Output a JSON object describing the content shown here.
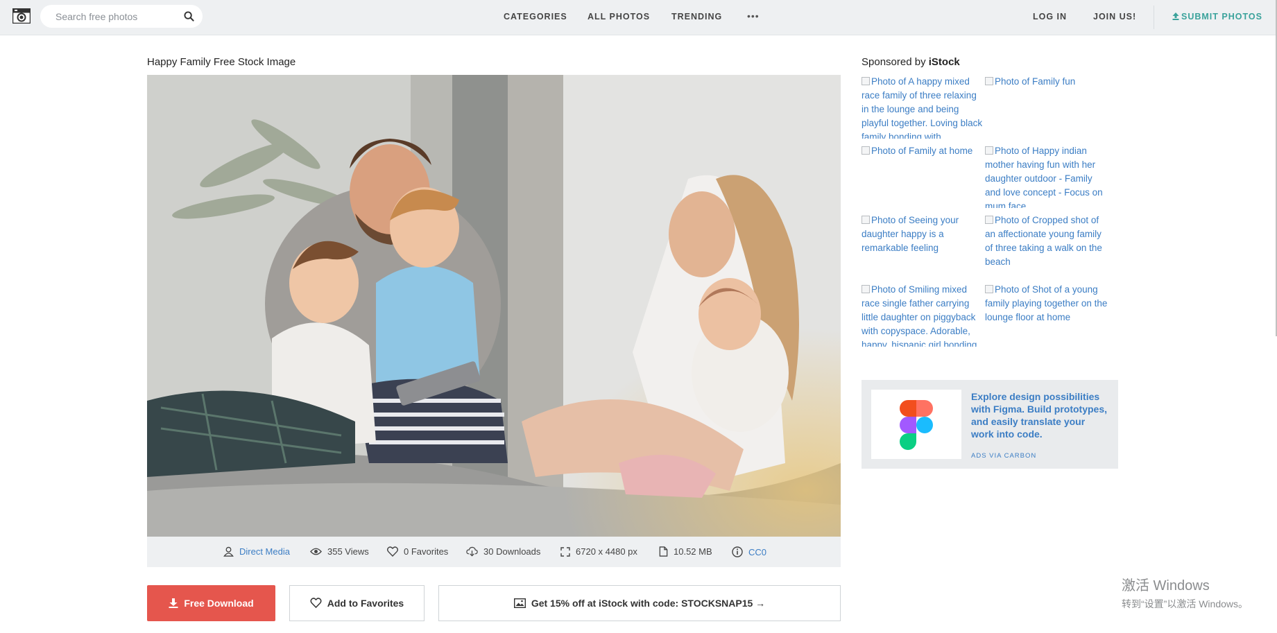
{
  "header": {
    "search_placeholder": "Search free photos",
    "nav": [
      "Categories",
      "All Photos",
      "Trending"
    ],
    "more": "•••",
    "login": "Log in",
    "join": "Join Us!",
    "submit": "Submit Photos"
  },
  "photo": {
    "title": "Happy Family Free Stock Image",
    "author": "Direct Media",
    "views": "355 Views",
    "favorites": "0 Favorites",
    "downloads": "30 Downloads",
    "dimensions": "6720 x 4480 px",
    "size": "10.52 MB",
    "license": "CC0"
  },
  "actions": {
    "download": "Free Download",
    "favorite": "Add to Favorites",
    "istock": "Get 15% off at iStock with code: STOCKSNAP15 →"
  },
  "sidebar": {
    "sponsored_prefix": "Sponsored by",
    "sponsored_brand": "iStock",
    "thumbs": [
      "Photo of A happy mixed race family of three relaxing in the lounge and being playful together. Loving black family bonding with",
      "Photo of Family fun",
      "Photo of Family at home",
      "Photo of Happy indian mother having fun with her daughter outdoor - Family and love concept - Focus on mum face",
      "Photo of Seeing your daughter happy is a remarkable feeling",
      "Photo of Cropped shot of an affectionate young family of three taking a walk on the beach",
      "Photo of Smiling mixed race single father carrying little daughter on piggyback with copyspace. Adorable, happy, hispanic girl bonding",
      "Photo of Shot of a young family playing together on the lounge floor at home"
    ],
    "ad": {
      "text": "Explore design possibilities with Figma. Build prototypes, and easily translate your work into code.",
      "via": "Ads via Carbon"
    }
  },
  "os_watermark": {
    "line1": "激活 Windows",
    "line2": "转到“设置”以激活 Windows。"
  },
  "colors": {
    "accent_link": "#3b7dc4",
    "download_button": "#e5564d",
    "submit_teal": "#3aa29b",
    "topbar_bg": "#eef0f2"
  }
}
